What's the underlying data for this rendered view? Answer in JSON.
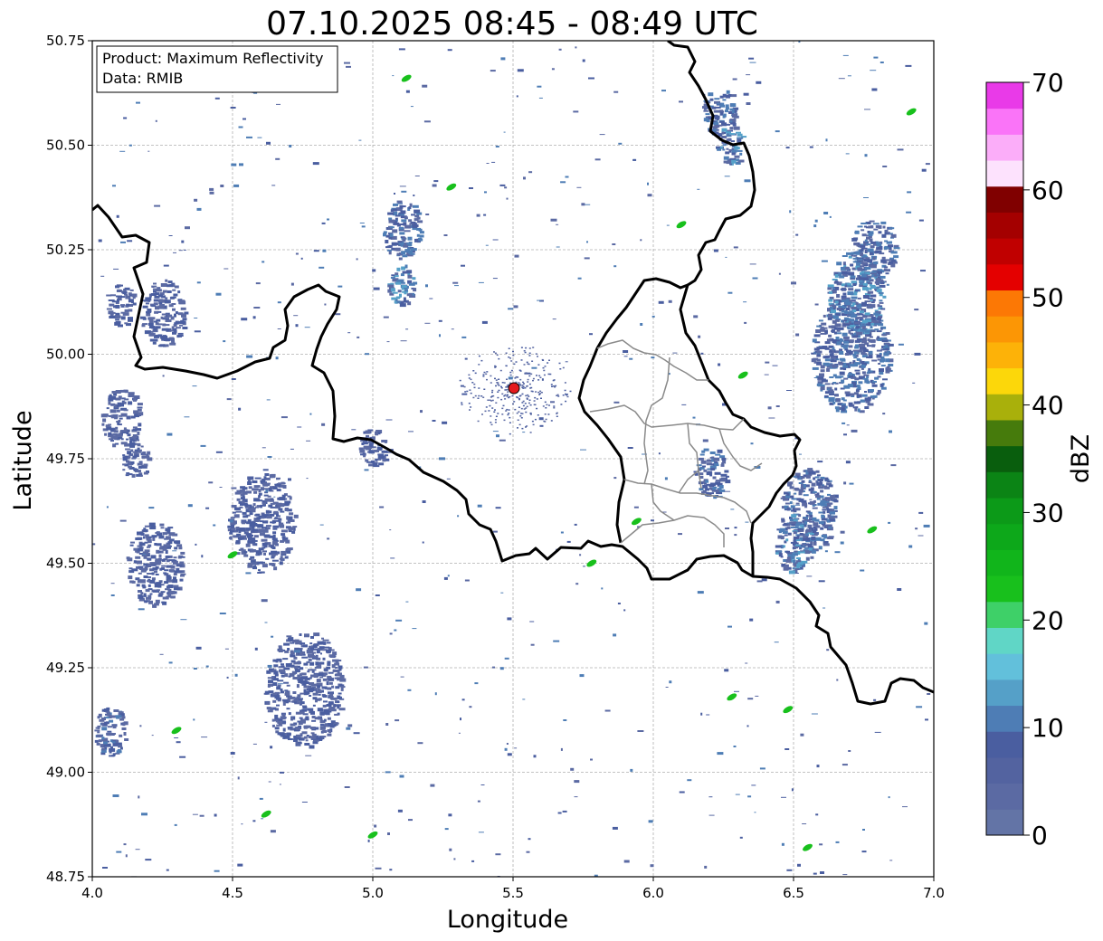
{
  "title": "07.10.2025 08:45 - 08:49 UTC",
  "info_box": {
    "product": "Product: Maximum Reflectivity",
    "data": "Data: RMIB"
  },
  "axes": {
    "xlabel": "Longitude",
    "ylabel": "Latitude",
    "xlim": [
      4.0,
      7.0
    ],
    "ylim": [
      48.75,
      50.75
    ],
    "xticks": [
      "4.0",
      "4.5",
      "5.0",
      "5.5",
      "6.0",
      "6.5",
      "7.0"
    ],
    "yticks": [
      "48.75",
      "49.00",
      "49.25",
      "49.50",
      "49.75",
      "50.00",
      "50.25",
      "50.50",
      "50.75"
    ],
    "grid": true
  },
  "colorbar": {
    "label": "dBZ",
    "min": 0,
    "max": 70,
    "ticks": [
      "0",
      "10",
      "20",
      "30",
      "40",
      "50",
      "60",
      "70"
    ],
    "colors": [
      "#6374a6",
      "#5b6aa3",
      "#5363a0",
      "#4a5ea0",
      "#4e7db5",
      "#55a0c8",
      "#62c0db",
      "#60d6c6",
      "#3ed068",
      "#18c01c",
      "#11b51b",
      "#0da81a",
      "#0c9a18",
      "#0b8415",
      "#095e0d",
      "#467b0c",
      "#a9b00b",
      "#fcd70a",
      "#fdb208",
      "#fc9605",
      "#fc7805",
      "#e40000",
      "#c00000",
      "#a40000",
      "#800000",
      "#fde2fd",
      "#fbadf9",
      "#fa74f8",
      "#e93ae8"
    ]
  },
  "radar_site": {
    "lon": 5.505,
    "lat": 49.915,
    "color": "#e41a1c"
  },
  "echo_color_legend_use": {
    "weak": "#5b6aa3",
    "moderate": "#4e7db5",
    "light_blue": "#62c0db",
    "green": "#18c01c"
  },
  "precip_areas": [
    {
      "lon": 6.7,
      "lat": 50.0,
      "rx": 0.14,
      "ry": 0.14,
      "level": 1
    },
    {
      "lon": 6.72,
      "lat": 50.15,
      "rx": 0.1,
      "ry": 0.1,
      "level": 2
    },
    {
      "lon": 6.78,
      "lat": 50.25,
      "rx": 0.08,
      "ry": 0.08,
      "level": 1
    },
    {
      "lon": 6.55,
      "lat": 49.63,
      "rx": 0.1,
      "ry": 0.1,
      "level": 1
    },
    {
      "lon": 6.5,
      "lat": 49.55,
      "rx": 0.07,
      "ry": 0.07,
      "level": 2
    },
    {
      "lon": 6.23,
      "lat": 50.58,
      "rx": 0.06,
      "ry": 0.06,
      "level": 1
    },
    {
      "lon": 6.27,
      "lat": 50.5,
      "rx": 0.05,
      "ry": 0.05,
      "level": 2
    },
    {
      "lon": 6.2,
      "lat": 49.72,
      "rx": 0.06,
      "ry": 0.06,
      "level": 1
    },
    {
      "lon": 5.1,
      "lat": 50.3,
      "rx": 0.07,
      "ry": 0.07,
      "level": 1
    },
    {
      "lon": 5.1,
      "lat": 50.17,
      "rx": 0.05,
      "ry": 0.05,
      "level": 2
    },
    {
      "lon": 4.6,
      "lat": 49.6,
      "rx": 0.12,
      "ry": 0.12,
      "level": 0
    },
    {
      "lon": 4.22,
      "lat": 49.5,
      "rx": 0.1,
      "ry": 0.1,
      "level": 0
    },
    {
      "lon": 4.06,
      "lat": 49.1,
      "rx": 0.06,
      "ry": 0.06,
      "level": 1
    },
    {
      "lon": 4.75,
      "lat": 49.2,
      "rx": 0.14,
      "ry": 0.14,
      "level": 0
    },
    {
      "lon": 4.1,
      "lat": 49.85,
      "rx": 0.07,
      "ry": 0.07,
      "level": 0
    },
    {
      "lon": 4.15,
      "lat": 49.75,
      "rx": 0.05,
      "ry": 0.05,
      "level": 0
    },
    {
      "lon": 4.25,
      "lat": 50.1,
      "rx": 0.08,
      "ry": 0.08,
      "level": 0
    },
    {
      "lon": 4.1,
      "lat": 50.12,
      "rx": 0.05,
      "ry": 0.05,
      "level": 0
    },
    {
      "lon": 5.0,
      "lat": 49.78,
      "rx": 0.05,
      "ry": 0.05,
      "level": 0
    }
  ],
  "small_cells": [
    {
      "lon": 6.92,
      "lat": 50.58,
      "level": 9
    },
    {
      "lon": 6.78,
      "lat": 49.58,
      "level": 9
    },
    {
      "lon": 5.28,
      "lat": 50.4,
      "level": 9
    },
    {
      "lon": 4.3,
      "lat": 49.1,
      "level": 9
    },
    {
      "lon": 6.55,
      "lat": 48.82,
      "level": 9
    },
    {
      "lon": 5.0,
      "lat": 48.85,
      "level": 9
    },
    {
      "lon": 4.62,
      "lat": 48.9,
      "level": 9
    },
    {
      "lon": 5.12,
      "lat": 50.66,
      "level": 9
    },
    {
      "lon": 6.1,
      "lat": 50.31,
      "level": 9
    },
    {
      "lon": 5.78,
      "lat": 49.5,
      "level": 9
    },
    {
      "lon": 6.32,
      "lat": 49.95,
      "level": 9
    },
    {
      "lon": 5.94,
      "lat": 49.6,
      "level": 9
    },
    {
      "lon": 4.5,
      "lat": 49.52,
      "level": 9
    },
    {
      "lon": 6.28,
      "lat": 49.18,
      "level": 9
    },
    {
      "lon": 6.48,
      "lat": 49.15,
      "level": 9
    }
  ]
}
